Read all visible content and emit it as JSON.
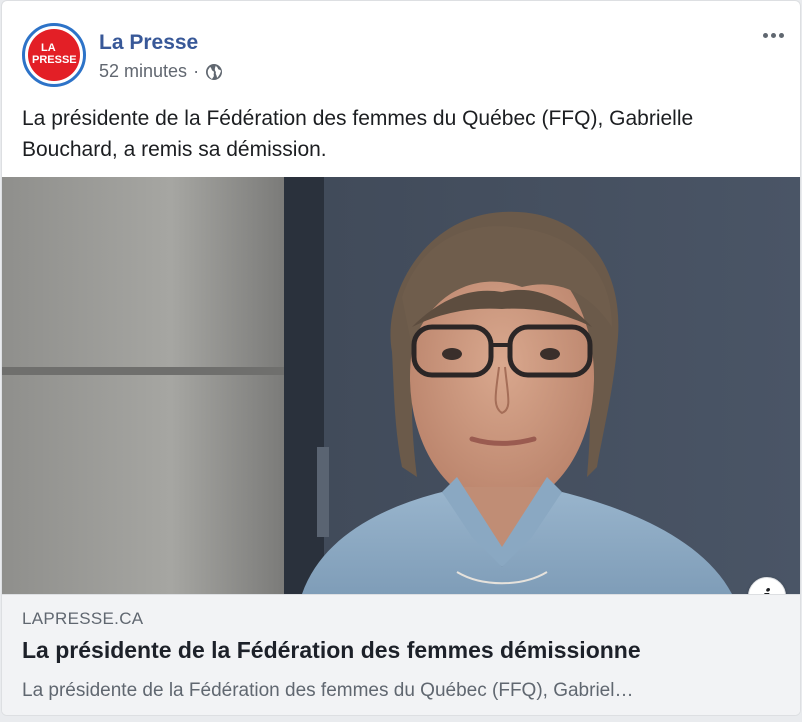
{
  "post": {
    "page_name": "La Presse",
    "logo_text_line1": "LA",
    "logo_text_line2": "PRESSE",
    "timestamp": "52 minutes",
    "separator": "·",
    "privacy_icon": "globe-icon",
    "more_icon": "more-horizontal-icon",
    "text_line1": "La présidente de la Fédération des femmes du Québec (FFQ), Gabrielle",
    "text_line2": "Bouchard, a remis sa démission."
  },
  "link_preview": {
    "domain": "LAPRESSE.CA",
    "title": "La présidente de la Fédération des femmes démissionne",
    "description": "La présidente de la Fédération des femmes du Québec (FFQ), Gabriel…",
    "info_icon_label": "i"
  },
  "colors": {
    "brand_red": "#e31f26",
    "page_name_blue": "#385898",
    "avatar_ring": "#2d73c8",
    "preview_bg": "#f2f3f5"
  }
}
